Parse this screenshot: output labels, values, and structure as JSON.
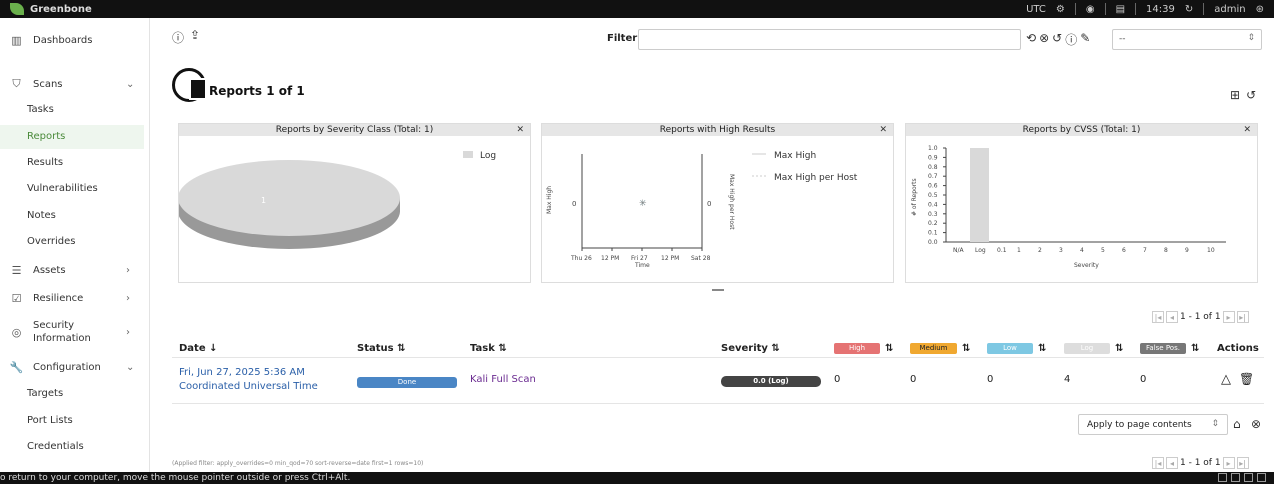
{
  "app": {
    "brand": "Greenbone"
  },
  "topbar": {
    "timezone": "UTC",
    "time": "14:39",
    "user": "admin"
  },
  "sidebar": {
    "dashboards": "Dashboards",
    "scans": "Scans",
    "scans_items": [
      "Tasks",
      "Reports",
      "Results",
      "Vulnerabilities",
      "Notes",
      "Overrides"
    ],
    "assets": "Assets",
    "resilience": "Resilience",
    "security_information": [
      "Security",
      "Information"
    ],
    "configuration": "Configuration",
    "configuration_items": [
      "Targets",
      "Port Lists",
      "Credentials"
    ]
  },
  "filter": {
    "label": "Filter",
    "value": "",
    "select_value": "--"
  },
  "page": {
    "title": "Reports 1 of 1"
  },
  "panels": {
    "severity_class": {
      "title": "Reports by Severity Class (Total: 1)",
      "legend": "Log",
      "slice_label": "1"
    },
    "high_results": {
      "title": "Reports with High Results",
      "legend": [
        "Max High",
        "Max High per Host"
      ],
      "y_left_label": "Max High",
      "y_right_label": "Max High per Host",
      "x_label": "Time",
      "x_ticks": [
        "Thu 26",
        "12 PM",
        "Fri 27",
        "12 PM",
        "Sat 28"
      ],
      "y_tick": "0"
    },
    "cvss": {
      "title": "Reports by CVSS (Total: 1)",
      "y_label": "# of Reports",
      "x_label": "Severity",
      "y_ticks": [
        "1.0",
        "0.9",
        "0.8",
        "0.7",
        "0.6",
        "0.5",
        "0.4",
        "0.3",
        "0.2",
        "0.1",
        "0.0"
      ],
      "x_ticks": [
        "N/A",
        "Log",
        "0.1",
        "1",
        "2",
        "3",
        "4",
        "5",
        "6",
        "7",
        "8",
        "9",
        "10"
      ]
    }
  },
  "chart_data": [
    {
      "type": "pie",
      "title": "Reports by Severity Class (Total: 1)",
      "categories": [
        "Log"
      ],
      "values": [
        1
      ],
      "legend": "top-right"
    },
    {
      "type": "line",
      "title": "Reports with High Results",
      "xlabel": "Time",
      "ylabel": "Max High",
      "series": [
        {
          "name": "Max High",
          "x": [
            "Fri 27"
          ],
          "values": [
            0
          ]
        },
        {
          "name": "Max High per Host",
          "x": [
            "Fri 27"
          ],
          "values": [
            0
          ]
        }
      ]
    },
    {
      "type": "bar",
      "title": "Reports by CVSS (Total: 1)",
      "xlabel": "Severity",
      "ylabel": "# of Reports",
      "categories": [
        "N/A",
        "Log",
        "0.1",
        "1",
        "2",
        "3",
        "4",
        "5",
        "6",
        "7",
        "8",
        "9",
        "10"
      ],
      "values": [
        0,
        1,
        0,
        0,
        0,
        0,
        0,
        0,
        0,
        0,
        0,
        0,
        0
      ],
      "ylim": [
        0,
        1.0
      ]
    }
  ],
  "pagination": {
    "text": "1 - 1 of 1"
  },
  "table": {
    "headers": {
      "date": "Date",
      "status": "Status",
      "task": "Task",
      "severity": "Severity",
      "high": "High",
      "medium": "Medium",
      "low": "Low",
      "log": "Log",
      "false_pos": "False Pos.",
      "actions": "Actions"
    },
    "rows": [
      {
        "date": "Fri, Jun 27, 2025 5:36 AM",
        "timezone": "Coordinated Universal Time",
        "status": "Done",
        "task": "Kali Full Scan",
        "severity": "0.0 (Log)",
        "high": "0",
        "medium": "0",
        "low": "0",
        "log": "4",
        "false_pos": "0"
      }
    ]
  },
  "bulk": {
    "apply_label": "Apply to page contents"
  },
  "applied_filter": "(Applied filter: apply_overrides=0 min_qod=70 sort-reverse=date first=1 rows=10)",
  "bottombar": {
    "message": "o return to your computer, move the mouse pointer outside or press Ctrl+Alt."
  },
  "colors": {
    "high": "#e57373",
    "medium": "#f0a830",
    "low": "#7ec8e3",
    "log": "#dddddd",
    "false_pos": "#777777",
    "done": "#4a86c5",
    "accent": "#4a8a3a"
  }
}
